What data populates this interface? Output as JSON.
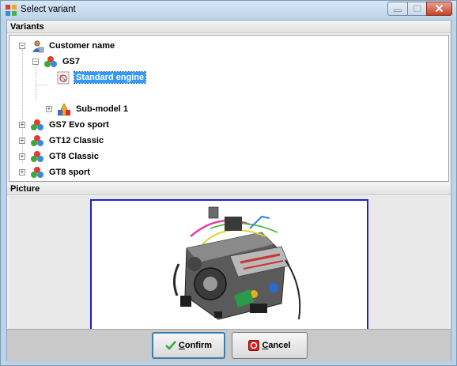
{
  "window": {
    "title": "Select variant"
  },
  "sections": {
    "variants": "Variants",
    "picture": "Picture"
  },
  "tree": {
    "root": "Customer name",
    "gs7": "GS7",
    "standard_engine": "Standard engine",
    "sub_model": "Sub-model 1",
    "gs7_evo": "GS7 Evo sport",
    "gt12": "GT12 Classic",
    "gt8_classic": "GT8 Classic",
    "gt8_sport": "GT8 sport"
  },
  "buttons": {
    "confirm_first": "C",
    "confirm_rest": "onfirm",
    "cancel_first": "C",
    "cancel_rest": "ancel"
  },
  "colors": {
    "selection": "#3399ff",
    "picture_border": "#2020c8",
    "confirm_icon": "#3aa83a",
    "cancel_icon": "#d42020"
  }
}
